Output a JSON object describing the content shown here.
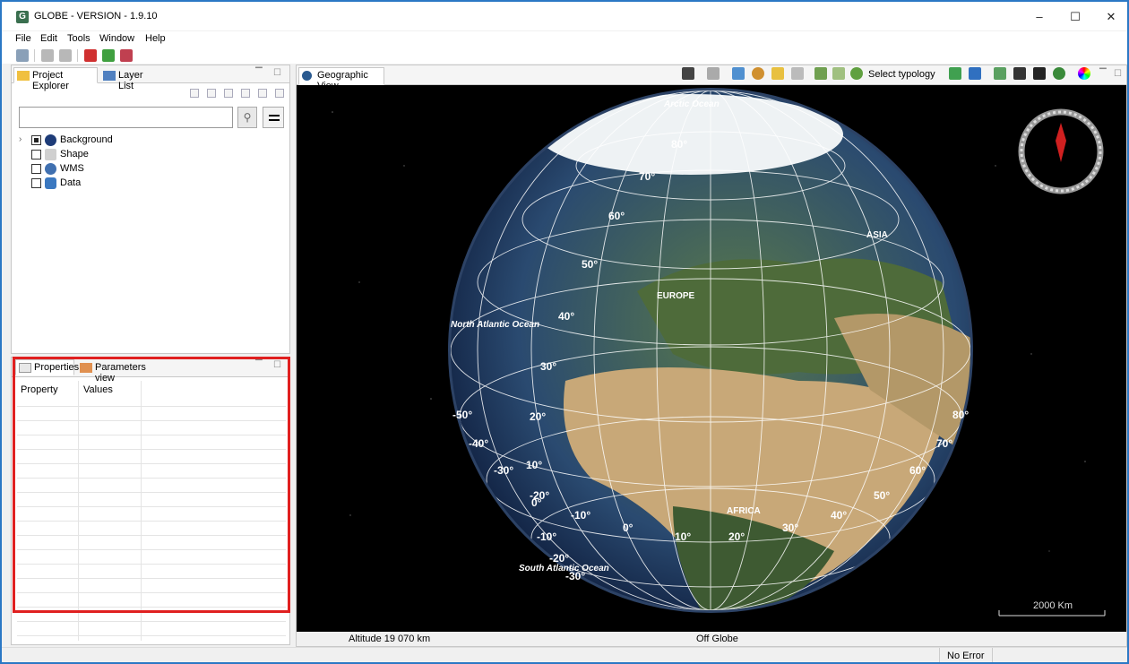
{
  "window": {
    "title": "GLOBE - VERSION - 1.9.10",
    "app_icon": "G"
  },
  "menu": [
    "File",
    "Edit",
    "Tools",
    "Window",
    "Help"
  ],
  "left_panel": {
    "tabs": [
      "Project Explorer",
      "Layer List"
    ],
    "search": {
      "value": "",
      "placeholder": ""
    },
    "tree": [
      {
        "label": "Background",
        "checked": true,
        "expandable": true
      },
      {
        "label": "Shape",
        "checked": false
      },
      {
        "label": "WMS",
        "checked": false
      },
      {
        "label": "Data",
        "checked": false
      }
    ]
  },
  "props_panel": {
    "tabs": [
      "Properties",
      "Parameters view"
    ],
    "columns": [
      "Property",
      "Values"
    ]
  },
  "geo": {
    "tab": "Geographic View",
    "toolbar_text": "Select typology",
    "labels": {
      "arctic": "Arctic Ocean",
      "asia": "ASIA",
      "europe": "EUROPE",
      "north_atlantic": "North Atlantic Ocean",
      "africa": "AFRICA",
      "south_atlantic": "South Atlantic Ocean"
    },
    "lat_labels": [
      "80°",
      "70°",
      "60°",
      "50°",
      "40°",
      "30°",
      "20°",
      "10°",
      "0°",
      "-10°",
      "-20°",
      "-30°"
    ],
    "lon_labels": [
      "-50°",
      "-40°",
      "-30°",
      "-20°",
      "-10°",
      "0°",
      "10°",
      "20°",
      "30°",
      "40°",
      "50°",
      "60°",
      "70°",
      "80°"
    ],
    "scale": "2000 Km",
    "altitude": "Altitude  19 070 km",
    "globe_status": "Off Globe"
  },
  "status": {
    "error": "No Error"
  },
  "colors": {
    "accent": "#2b78c5",
    "highlight": "#e02020",
    "ocean": "#1e3c78",
    "land_green": "#4a6a3a",
    "desert": "#c8a878"
  }
}
